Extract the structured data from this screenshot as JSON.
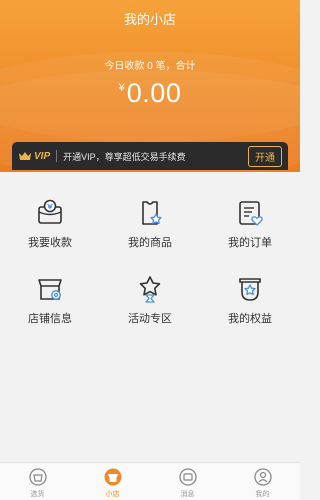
{
  "header": {
    "title": "我的小店",
    "income_label": "今日收款 0 笔，合计",
    "currency": "¥",
    "amount": "0.00"
  },
  "vip": {
    "logo_text": "VIP",
    "message": "开通VIP，尊享超低交易手续费",
    "button_label": "开通"
  },
  "menu": [
    {
      "label": "我要收款",
      "icon": "cash-register-icon"
    },
    {
      "label": "我的商品",
      "icon": "product-shirt-icon"
    },
    {
      "label": "我的订单",
      "icon": "order-list-icon"
    },
    {
      "label": "店铺信息",
      "icon": "store-settings-icon"
    },
    {
      "label": "活动专区",
      "icon": "activity-icon"
    },
    {
      "label": "我的权益",
      "icon": "rights-badge-icon"
    }
  ],
  "tabbar": [
    {
      "label": "选货",
      "icon": "select-goods-icon",
      "active": false
    },
    {
      "label": "小店",
      "icon": "shop-icon",
      "active": true
    },
    {
      "label": "消息",
      "icon": "message-icon",
      "active": false
    },
    {
      "label": "我的",
      "icon": "profile-icon",
      "active": false
    }
  ],
  "colors": {
    "accent": "#ee8a2a",
    "vip_gold": "#e9b24c",
    "vip_bg": "#2b2b2b"
  }
}
